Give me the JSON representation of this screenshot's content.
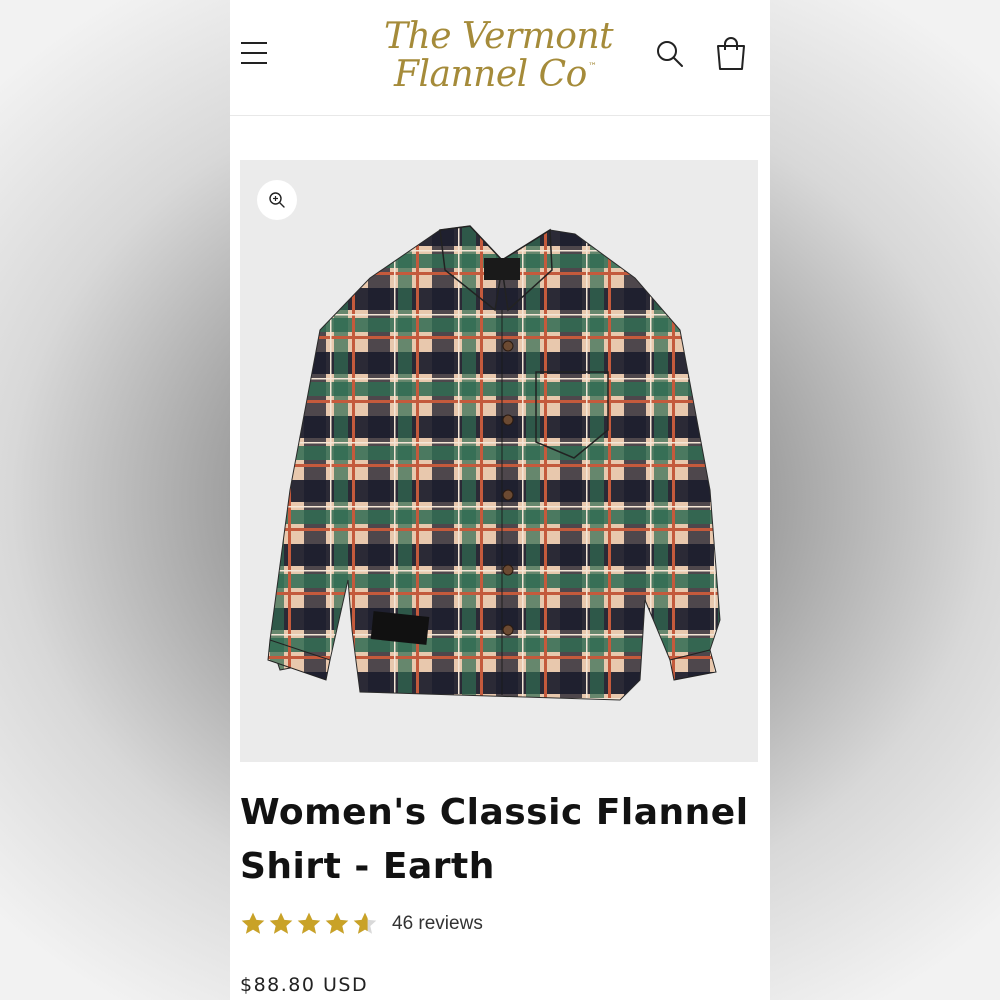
{
  "brand": {
    "line1": "The Vermont",
    "line2": "Flannel Co",
    "trademark": "™"
  },
  "header": {
    "menu_icon": "hamburger-menu-icon",
    "search_icon": "search-icon",
    "cart_icon": "shopping-bag-icon"
  },
  "product": {
    "title": "Women's Classic Flannel Shirt - Earth",
    "rating": 4.6,
    "reviews_label": "46 reviews",
    "price": "$88.80 USD",
    "media": {
      "zoom_icon": "zoom-in-icon",
      "image_subject": "flannel shirt"
    }
  },
  "colors": {
    "brand_gold": "#a58b3a",
    "star_gold": "#c9a227",
    "star_empty": "#d9d9d9"
  }
}
